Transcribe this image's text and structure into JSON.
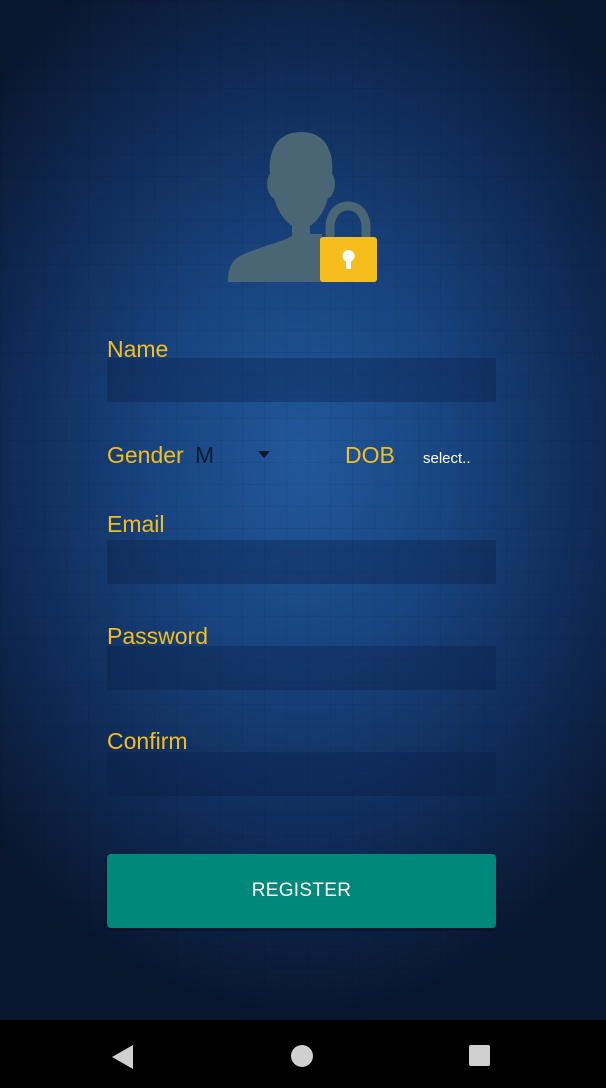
{
  "form": {
    "name_label": "Name",
    "name_value": "",
    "gender_label": "Gender",
    "gender_value": "M",
    "dob_label": "DOB",
    "dob_value": "select..",
    "email_label": "Email",
    "email_value": "",
    "password_label": "Password",
    "password_value": "",
    "confirm_label": "Confirm",
    "confirm_value": ""
  },
  "register_button": {
    "label": "REGISTER"
  },
  "icons": {
    "header": "user-lock-icon",
    "nav_back": "back-icon",
    "nav_home": "home-icon",
    "nav_recent": "recent-apps-icon",
    "gender_dropdown": "dropdown-arrow-icon"
  },
  "colors": {
    "label": "#f4bf1d",
    "button": "#00897b",
    "avatar": "#4a6675",
    "lock": "#f4bf1d"
  }
}
